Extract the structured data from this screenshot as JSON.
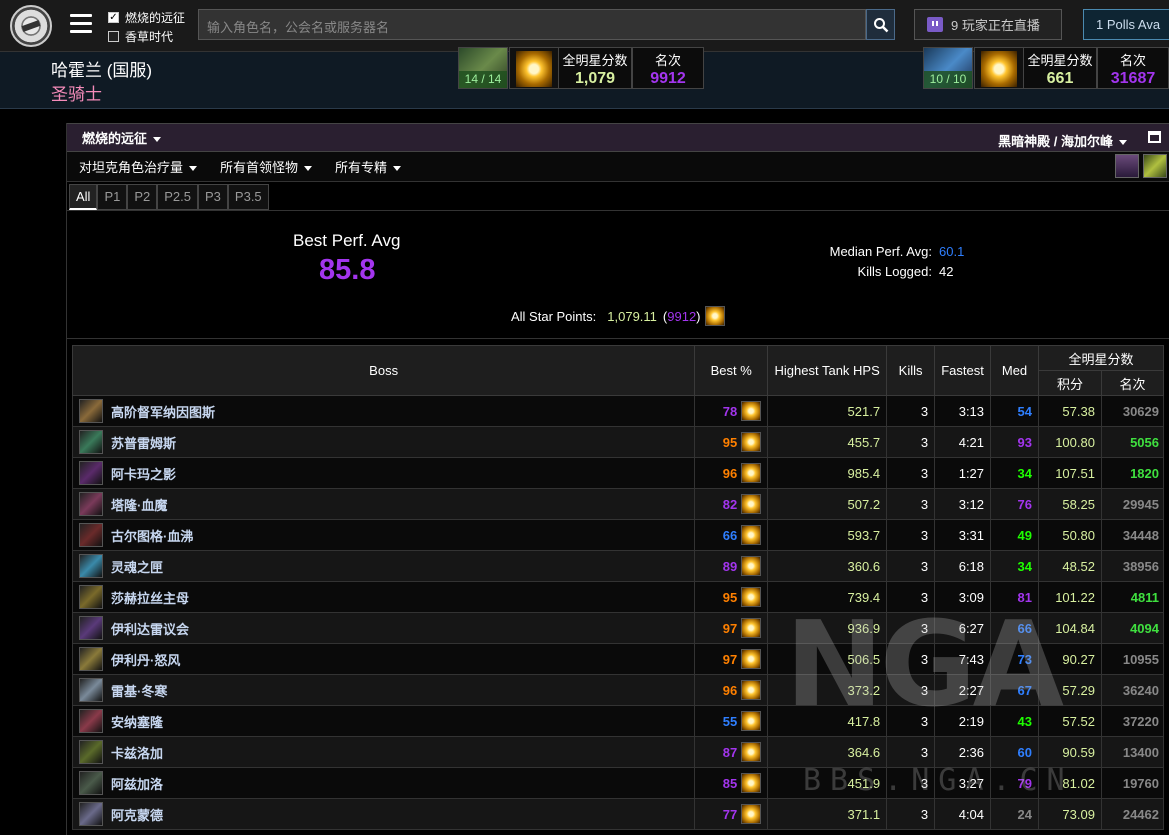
{
  "topbar": {
    "checks": [
      {
        "label": "燃烧的远征",
        "checked": true
      },
      {
        "label": "香草时代",
        "checked": false
      }
    ],
    "search_placeholder": "输入角色名，公会名或服务器名",
    "twitch_label": "9 玩家正在直播",
    "polls_label": "1 Polls Ava"
  },
  "character": {
    "name": "哈霍兰 (国服)",
    "class": "圣骑士",
    "class_color": "#f58cba",
    "zone1": {
      "count": "14 / 14",
      "stars_label": "全明星分数",
      "stars_value": "1,079",
      "rank_label": "名次",
      "rank_value": "9912"
    },
    "zone2": {
      "count": "10 / 10",
      "stars_label": "全明星分数",
      "stars_value": "661",
      "rank_label": "名次",
      "rank_value": "31687"
    }
  },
  "panel": {
    "expansion": "燃烧的远征",
    "realm": "黑暗神殿 / 海加尔峰",
    "filters": [
      "对坦克角色治疗量",
      "所有首领怪物",
      "所有专精"
    ],
    "phases": [
      "All",
      "P1",
      "P2",
      "P2.5",
      "P3",
      "P3.5"
    ],
    "active_phase": "All"
  },
  "summary": {
    "best_label": "Best Perf. Avg",
    "best_value": "85.8",
    "median_label": "Median Perf. Avg:",
    "median_value": "60.1",
    "kills_label": "Kills Logged:",
    "kills_value": "42",
    "asp_label": "All Star Points:",
    "asp_points": "1,079.11",
    "asp_open": " (",
    "asp_rank": "9912",
    "asp_close": ")"
  },
  "table": {
    "headers": {
      "boss": "Boss",
      "best": "Best %",
      "hps": "Highest Tank HPS",
      "kills": "Kills",
      "fastest": "Fastest",
      "med": "Med",
      "allstar": "全明星分数",
      "points": "积分",
      "rank": "名次"
    },
    "rows": [
      {
        "name": "高阶督军纳因图斯",
        "best": "78",
        "hps": "521.7",
        "kills": "3",
        "fastest": "3:13",
        "med": "54",
        "points": "57.38",
        "rank": "30629",
        "best_color": "#a335ee",
        "med_color": "#2f7fff",
        "rank_color": "#888888",
        "icon_color": "#8a6a3a"
      },
      {
        "name": "苏普雷姆斯",
        "best": "95",
        "hps": "455.7",
        "kills": "3",
        "fastest": "4:21",
        "med": "93",
        "points": "100.80",
        "rank": "5056",
        "best_color": "#ff8000",
        "med_color": "#a335ee",
        "rank_color": "#3fe03f",
        "icon_color": "#3a7a5a"
      },
      {
        "name": "阿卡玛之影",
        "best": "96",
        "hps": "985.4",
        "kills": "3",
        "fastest": "1:27",
        "med": "34",
        "points": "107.51",
        "rank": "1820",
        "best_color": "#ff8000",
        "med_color": "#1eff00",
        "rank_color": "#3fe03f",
        "icon_color": "#5a2a6a"
      },
      {
        "name": "塔隆·血魔",
        "best": "82",
        "hps": "507.2",
        "kills": "3",
        "fastest": "3:12",
        "med": "76",
        "points": "58.25",
        "rank": "29945",
        "best_color": "#a335ee",
        "med_color": "#a335ee",
        "rank_color": "#888888",
        "icon_color": "#7a3a5a"
      },
      {
        "name": "古尔图格·血沸",
        "best": "66",
        "hps": "593.7",
        "kills": "3",
        "fastest": "3:31",
        "med": "49",
        "points": "50.80",
        "rank": "34448",
        "best_color": "#2f7fff",
        "med_color": "#1eff00",
        "rank_color": "#888888",
        "icon_color": "#6a2a2a"
      },
      {
        "name": "灵魂之匣",
        "best": "89",
        "hps": "360.6",
        "kills": "3",
        "fastest": "6:18",
        "med": "34",
        "points": "48.52",
        "rank": "38956",
        "best_color": "#a335ee",
        "med_color": "#1eff00",
        "rank_color": "#888888",
        "icon_color": "#3a8aaa"
      },
      {
        "name": "莎赫拉丝主母",
        "best": "95",
        "hps": "739.4",
        "kills": "3",
        "fastest": "3:09",
        "med": "81",
        "points": "101.22",
        "rank": "4811",
        "best_color": "#ff8000",
        "med_color": "#a335ee",
        "rank_color": "#3fe03f",
        "icon_color": "#7a6a2a"
      },
      {
        "name": "伊利达雷议会",
        "best": "97",
        "hps": "936.9",
        "kills": "3",
        "fastest": "6:27",
        "med": "66",
        "points": "104.84",
        "rank": "4094",
        "best_color": "#ff8000",
        "med_color": "#2f7fff",
        "rank_color": "#3fe03f",
        "icon_color": "#5a3a7a"
      },
      {
        "name": "伊利丹·怒风",
        "best": "97",
        "hps": "506.5",
        "kills": "3",
        "fastest": "7:43",
        "med": "73",
        "points": "90.27",
        "rank": "10955",
        "best_color": "#ff8000",
        "med_color": "#2f7fff",
        "rank_color": "#888888",
        "icon_color": "#8a7a3a"
      },
      {
        "name": "雷基·冬寒",
        "best": "96",
        "hps": "373.2",
        "kills": "3",
        "fastest": "2:27",
        "med": "67",
        "points": "57.29",
        "rank": "36240",
        "best_color": "#ff8000",
        "med_color": "#2f7fff",
        "rank_color": "#888888",
        "icon_color": "#7a8a9a"
      },
      {
        "name": "安纳塞隆",
        "best": "55",
        "hps": "417.8",
        "kills": "3",
        "fastest": "2:19",
        "med": "43",
        "points": "57.52",
        "rank": "37220",
        "best_color": "#2f7fff",
        "med_color": "#1eff00",
        "rank_color": "#888888",
        "icon_color": "#8a3a4a"
      },
      {
        "name": "卡兹洛加",
        "best": "87",
        "hps": "364.6",
        "kills": "3",
        "fastest": "2:36",
        "med": "60",
        "points": "90.59",
        "rank": "13400",
        "best_color": "#a335ee",
        "med_color": "#2f7fff",
        "rank_color": "#888888",
        "icon_color": "#5a6a2a"
      },
      {
        "name": "阿兹加洛",
        "best": "85",
        "hps": "451.9",
        "kills": "3",
        "fastest": "3:27",
        "med": "79",
        "points": "81.02",
        "rank": "19760",
        "best_color": "#a335ee",
        "med_color": "#a335ee",
        "rank_color": "#888888",
        "icon_color": "#4a5a4a"
      },
      {
        "name": "阿克蒙德",
        "best": "77",
        "hps": "371.1",
        "kills": "3",
        "fastest": "4:04",
        "med": "24",
        "points": "73.09",
        "rank": "24462",
        "best_color": "#a335ee",
        "med_color": "#888888",
        "rank_color": "#888888",
        "icon_color": "#6a6a8a"
      }
    ]
  },
  "watermark": {
    "big": "NGA",
    "small": "BBS.NGA.CN"
  }
}
